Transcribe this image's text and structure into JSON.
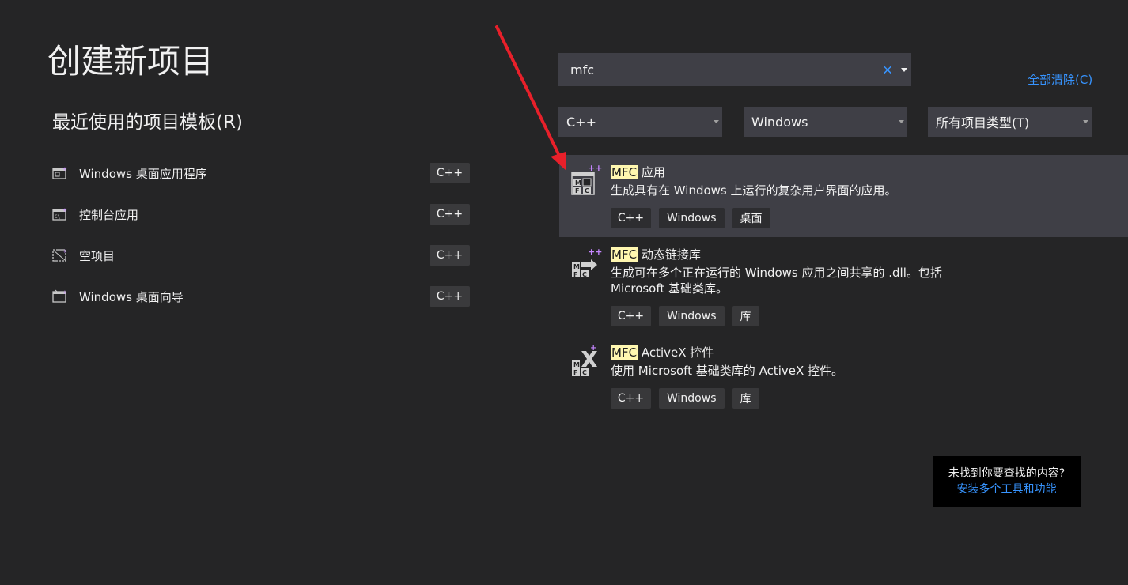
{
  "page": {
    "title": "创建新项目",
    "recent_title": "最近使用的项目模板(R)"
  },
  "recent": [
    {
      "label": "Windows 桌面应用程序",
      "tag": "C++",
      "icon": "windows-desktop-app-icon"
    },
    {
      "label": "控制台应用",
      "tag": "C++",
      "icon": "console-app-icon"
    },
    {
      "label": "空项目",
      "tag": "C++",
      "icon": "empty-project-icon"
    },
    {
      "label": "Windows 桌面向导",
      "tag": "C++",
      "icon": "windows-desktop-wizard-icon"
    }
  ],
  "search": {
    "value": "mfc",
    "clear_glyph": "×",
    "clear_all": "全部清除(C)"
  },
  "filters": {
    "language": "C++",
    "platform": "Windows",
    "project_type": "所有项目类型(T)"
  },
  "results": [
    {
      "highlight": "MFC",
      "title_rest": " 应用",
      "desc": "生成具有在 Windows 上运行的复杂用户界面的应用。",
      "tags": [
        "C++",
        "Windows",
        "桌面"
      ],
      "icon": "mfc-app-icon",
      "selected": true
    },
    {
      "highlight": "MFC",
      "title_rest": " 动态链接库",
      "desc_line1": "生成可在多个正在运行的 Windows 应用之间共享的 .dll。包括",
      "desc_line2": "Microsoft 基础类库。",
      "tags": [
        "C++",
        "Windows",
        "库"
      ],
      "icon": "mfc-dll-icon"
    },
    {
      "highlight": "MFC",
      "title_rest": " ActiveX 控件",
      "desc": "使用 Microsoft 基础类库的 ActiveX 控件。",
      "tags": [
        "C++",
        "Windows",
        "库"
      ],
      "icon": "mfc-activex-icon"
    }
  ],
  "notfound": {
    "question": "未找到你要查找的内容?",
    "link": "安装多个工具和功能"
  },
  "colors": {
    "background": "#252526",
    "panel": "#3f3f46",
    "link": "#3794ff",
    "highlight": "#fff7b0",
    "arrow": "#e8202a"
  }
}
